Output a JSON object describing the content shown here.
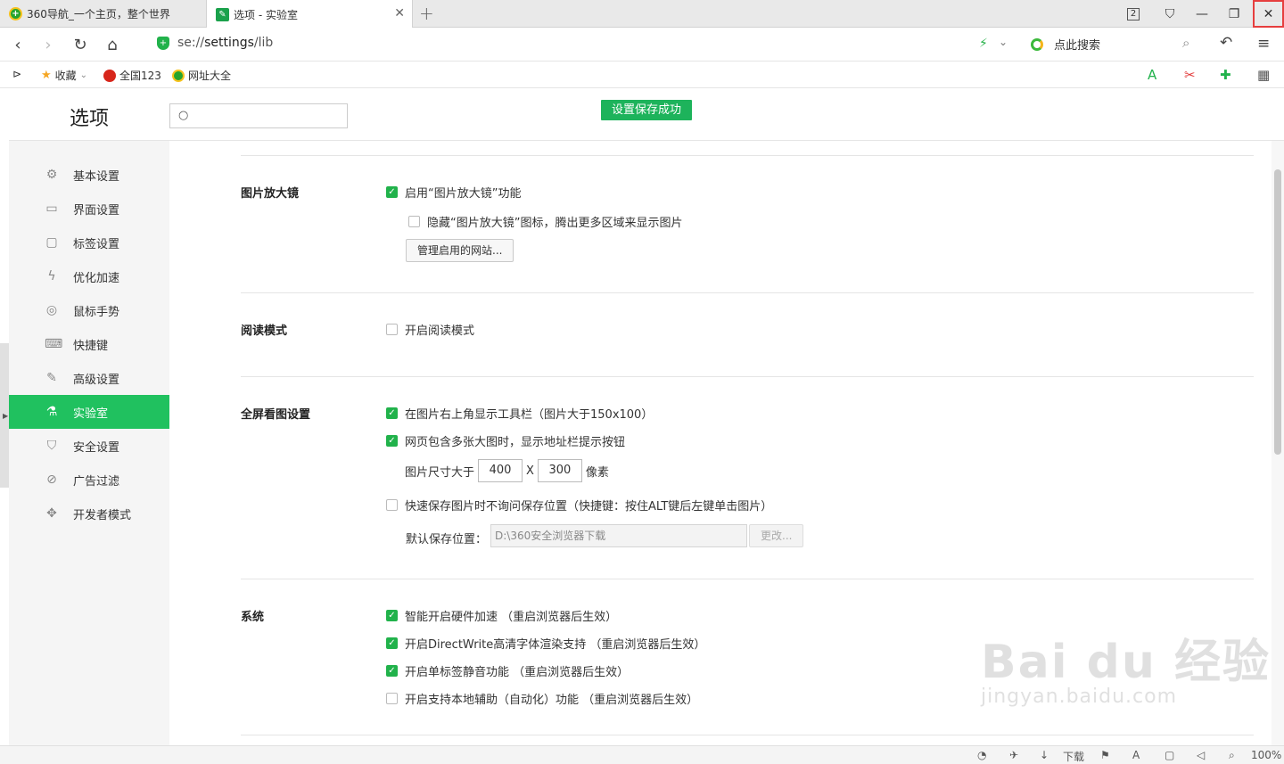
{
  "tabs": [
    {
      "label": "360导航_一个主页，整个世界",
      "active": false
    },
    {
      "label": "选项 - 实验室",
      "active": true
    }
  ],
  "window": {
    "tab_count": "2"
  },
  "address": {
    "scheme": "se://",
    "path": "settings",
    "suffix": "/lib"
  },
  "search_engine": {
    "label": "点此搜索"
  },
  "bookmarks": [
    {
      "label": "收藏"
    },
    {
      "label": "全国123"
    },
    {
      "label": "网址大全"
    }
  ],
  "settings": {
    "title": "选项",
    "search_placeholder": "",
    "toast": "设置保存成功"
  },
  "sidebar": {
    "items": [
      {
        "label": "基本设置",
        "icon": "gear-icon"
      },
      {
        "label": "界面设置",
        "icon": "window-icon"
      },
      {
        "label": "标签设置",
        "icon": "tab-icon"
      },
      {
        "label": "优化加速",
        "icon": "bolt-icon"
      },
      {
        "label": "鼠标手势",
        "icon": "mouse-icon"
      },
      {
        "label": "快捷键",
        "icon": "keyboard-icon"
      },
      {
        "label": "高级设置",
        "icon": "wrench-icon"
      },
      {
        "label": "实验室",
        "icon": "flask-icon",
        "active": true
      },
      {
        "label": "安全设置",
        "icon": "shield-icon"
      },
      {
        "label": "广告过滤",
        "icon": "block-icon"
      },
      {
        "label": "开发者模式",
        "icon": "puzzle-icon"
      }
    ]
  },
  "sections": {
    "magnifier": {
      "title": "图片放大镜",
      "enable": "启用“图片放大镜”功能",
      "enable_checked": true,
      "hide_icon": "隐藏“图片放大镜”图标，腾出更多区域来显示图片",
      "hide_icon_checked": false,
      "manage_button": "管理启用的网站..."
    },
    "reading": {
      "title": "阅读模式",
      "enable": "开启阅读模式",
      "enable_checked": false
    },
    "fullscreen": {
      "title": "全屏看图设置",
      "toolbar": "在图片右上角显示工具栏（图片大于150x100）",
      "toolbar_checked": true,
      "addressbar": "网页包含多张大图时，显示地址栏提示按钮",
      "addressbar_checked": true,
      "size_label": "图片尺寸大于",
      "width": "400",
      "times": "X",
      "height": "300",
      "unit": "像素",
      "quick_save": "快速保存图片时不询问保存位置（快捷键：按住ALT键后左键单击图片）",
      "quick_save_checked": false,
      "default_location_label": "默认保存位置：",
      "default_location": "D:\\360安全浏览器下载",
      "change_button": "更改..."
    },
    "system": {
      "title": "系统",
      "hw_accel": "智能开启硬件加速 （重启浏览器后生效）",
      "hw_accel_checked": true,
      "directwrite": "开启DirectWrite高清字体渲染支持 （重启浏览器后生效）",
      "directwrite_checked": true,
      "mute_tab": "开启单标签静音功能 （重启浏览器后生效）",
      "mute_tab_checked": true,
      "accessibility": "开启支持本地辅助（自动化）功能 （重启浏览器后生效）",
      "accessibility_checked": false
    }
  },
  "statusbar": {
    "download": "下载",
    "zoom": "100%"
  },
  "watermark": {
    "main": "Bai du 经验",
    "sub": "jingyan.baidu.com"
  },
  "colors": {
    "accent": "#20c15f",
    "check": "#21b24b",
    "close_highlight": "#e63e3e"
  }
}
